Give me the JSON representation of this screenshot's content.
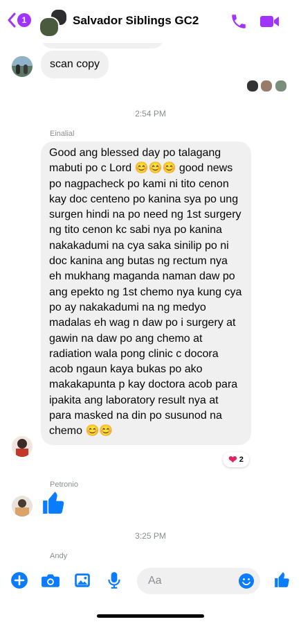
{
  "header": {
    "unread_count": "1",
    "title": "Salvador Siblings GC2"
  },
  "messages": {
    "scan_copy": "scan copy",
    "time1": "2:54 PM",
    "sender1": "Einalial",
    "long_text": "Good ang blessed day po talagang mabuti po c Lord 😊😊😊 good news po nagpacheck po kami ni tito cenon kay doc centeno po kanina sya po ung surgen hindi na po need ng 1st surgery ng tito cenon kc sabi nya po kanina nakakadumi na cya saka sinilip po ni doc kanina ang butas ng rectum nya eh mukhang maganda naman daw po ang epekto ng 1st chemo nya kung cya po ay nakakadumi na ng medyo madalas eh wag n daw po i surgery at gawin na daw po ang chemo at radiation wala pong clinic c docora acob ngaun kaya bukas po ako makakapunta p kay doctora acob para ipakita ang laboratory result nya at para masked na din po susunod na chemo 😊😊",
    "reaction_count": "2",
    "sender2": "Petronio",
    "time2": "3:25 PM",
    "sender3": "Andy"
  },
  "composer": {
    "placeholder": "Aa"
  },
  "colors": {
    "accent": "#a033ff",
    "messenger_blue": "#0a7cff",
    "bubble_gray": "#f0f0f0"
  },
  "icons": [
    "back-icon",
    "phone-icon",
    "video-icon",
    "plus-icon",
    "camera-icon",
    "gallery-icon",
    "mic-icon",
    "emoji-icon",
    "thumbs-up-icon"
  ]
}
